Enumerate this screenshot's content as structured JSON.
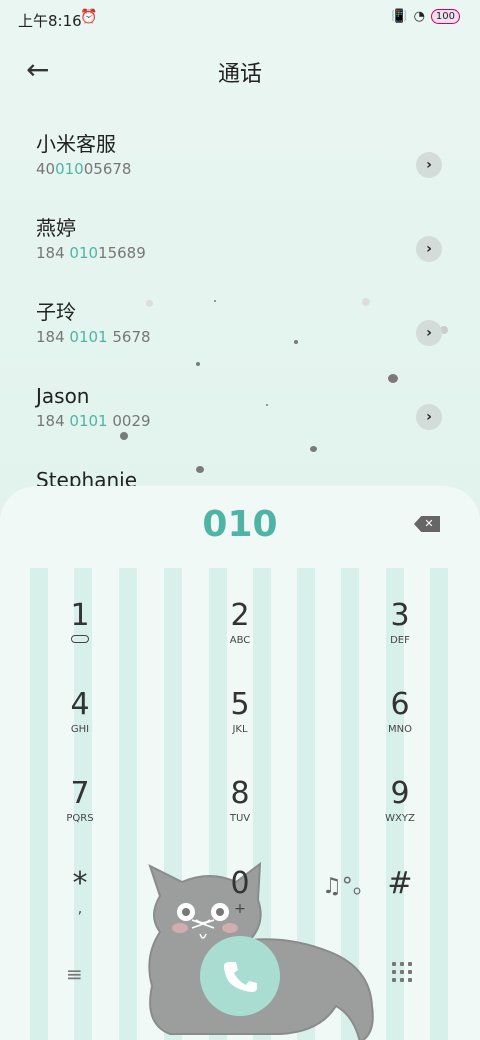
{
  "status_bar": {
    "time": "上午8:16",
    "battery": "100"
  },
  "header": {
    "title": "通话"
  },
  "contacts": [
    {
      "name": "小米客服",
      "num_pre": "40",
      "num_hl": "010",
      "num_post": "05678"
    },
    {
      "name": "燕婷",
      "num_pre": "184 ",
      "num_hl": "010",
      "num_post": "15689"
    },
    {
      "name": "子玲",
      "num_pre": "184 ",
      "num_hl": "0101",
      "num_post": " 5678"
    },
    {
      "name": "Jason",
      "num_pre": "184 ",
      "num_hl": "0101",
      "num_post": " 0029"
    },
    {
      "name": "Stephanie",
      "num_pre": "",
      "num_hl": "",
      "num_post": ""
    }
  ],
  "dialer": {
    "input": "010",
    "keys": [
      {
        "digit": "1",
        "letters": ""
      },
      {
        "digit": "2",
        "letters": "ABC"
      },
      {
        "digit": "3",
        "letters": "DEF"
      },
      {
        "digit": "4",
        "letters": "GHI"
      },
      {
        "digit": "5",
        "letters": "JKL"
      },
      {
        "digit": "6",
        "letters": "MNO"
      },
      {
        "digit": "7",
        "letters": "PQRS"
      },
      {
        "digit": "8",
        "letters": "TUV"
      },
      {
        "digit": "9",
        "letters": "WXYZ"
      },
      {
        "digit": "*",
        "letters": ","
      },
      {
        "digit": "0",
        "letters": "+"
      },
      {
        "digit": "#",
        "letters": ""
      }
    ]
  },
  "icons": {
    "back": "arrow-left-icon",
    "chevron": "chevron-right-icon",
    "delete": "backspace-icon",
    "call": "phone-icon",
    "menu": "menu-icon",
    "keypad": "keypad-icon"
  },
  "colors": {
    "accent": "#4fb4a5",
    "call_button": "#a9ddd2"
  }
}
